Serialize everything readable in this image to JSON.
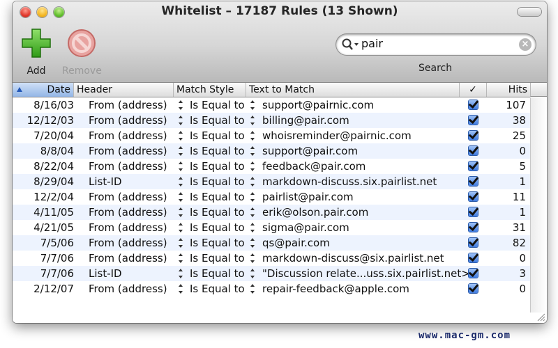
{
  "window": {
    "title": "Whitelist – 17187 Rules (13 Shown)"
  },
  "toolbar": {
    "add_label": "Add",
    "remove_label": "Remove",
    "search_label": "Search",
    "search_value": "pair"
  },
  "table": {
    "columns": [
      "Date",
      "Header",
      "Match Style",
      "Text to Match",
      "✓",
      "Hits"
    ],
    "rows": [
      {
        "date": "8/16/03",
        "header": "From (address)",
        "match": "Is Equal to",
        "text": "support@pairnic.com",
        "checked": true,
        "hits": "107"
      },
      {
        "date": "12/12/03",
        "header": "From (address)",
        "match": "Is Equal to",
        "text": "billing@pair.com",
        "checked": true,
        "hits": "38"
      },
      {
        "date": "7/20/04",
        "header": "From (address)",
        "match": "Is Equal to",
        "text": "whoisreminder@pairnic.com",
        "checked": true,
        "hits": "25"
      },
      {
        "date": "8/8/04",
        "header": "From (address)",
        "match": "Is Equal to",
        "text": "support@pair.com",
        "checked": true,
        "hits": "0"
      },
      {
        "date": "8/22/04",
        "header": "From (address)",
        "match": "Is Equal to",
        "text": "feedback@pair.com",
        "checked": true,
        "hits": "5"
      },
      {
        "date": "8/29/04",
        "header": "List-ID",
        "match": "Is Equal to",
        "text": "markdown-discuss.six.pairlist.net",
        "checked": true,
        "hits": "1"
      },
      {
        "date": "12/2/04",
        "header": "From (address)",
        "match": "Is Equal to",
        "text": "pairlist@pair.com",
        "checked": true,
        "hits": "11"
      },
      {
        "date": "4/11/05",
        "header": "From (address)",
        "match": "Is Equal to",
        "text": "erik@olson.pair.com",
        "checked": true,
        "hits": "1"
      },
      {
        "date": "4/21/05",
        "header": "From (address)",
        "match": "Is Equal to",
        "text": "sigma@pair.com",
        "checked": true,
        "hits": "31"
      },
      {
        "date": "7/5/06",
        "header": "From (address)",
        "match": "Is Equal to",
        "text": "qs@pair.com",
        "checked": true,
        "hits": "82"
      },
      {
        "date": "7/7/06",
        "header": "From (address)",
        "match": "Is Equal to",
        "text": "markdown-discuss@six.pairlist.net",
        "checked": true,
        "hits": "0"
      },
      {
        "date": "7/7/06",
        "header": "List-ID",
        "match": "Is Equal to",
        "text": "\"Discussion relate...uss.six.pairlist.net>",
        "checked": true,
        "hits": "3"
      },
      {
        "date": "2/12/07",
        "header": "From (address)",
        "match": "Is Equal to",
        "text": "repair-feedback@apple.com",
        "checked": true,
        "hits": "0"
      }
    ]
  },
  "watermark": "www.mac-gm.com",
  "colors": {
    "selection_blue": "#3f7be0",
    "row_alt": "#edf3fe"
  },
  "icons": {
    "add": "plus-icon",
    "remove": "no-entry-icon",
    "search": "magnifier-icon",
    "clear": "clear-x-icon"
  }
}
